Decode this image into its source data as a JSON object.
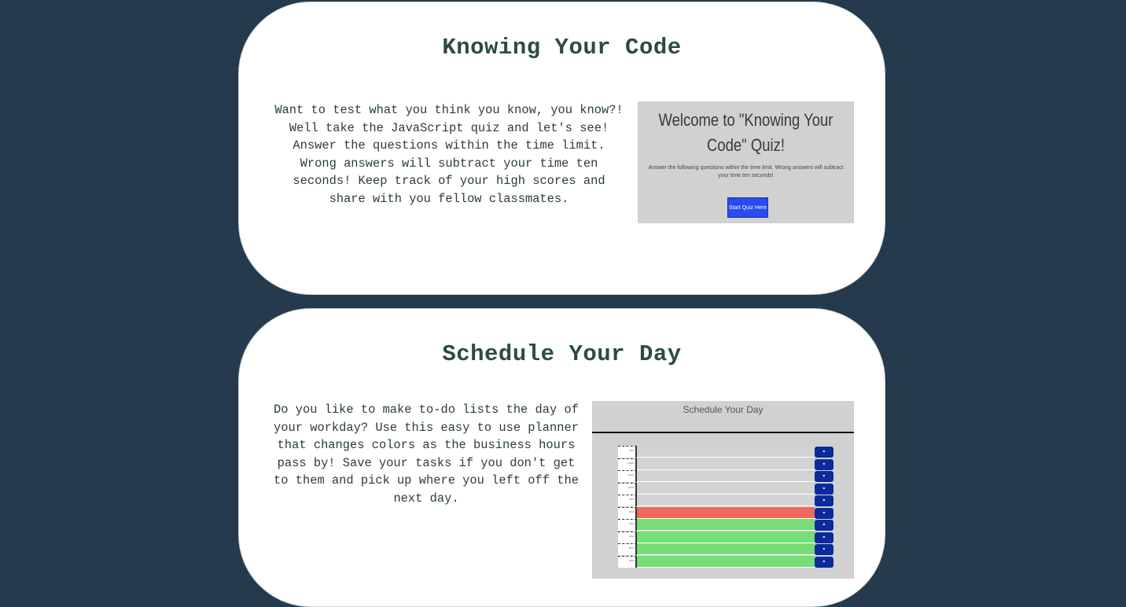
{
  "projects": [
    {
      "title": "Knowing Your Code",
      "description": "Want to test what you think you know, you know?! Well take the JavaScript quiz and let's see! Answer the questions within the time limit. Wrong answers will subtract your time ten seconds! Keep track of your high scores and share with you fellow classmates.",
      "preview": {
        "heading": "Welcome to \"Knowing Your Code\" Quiz!",
        "text": "Answer the following questions within the time limit. Wrong answers will subtract your time ten seconds!",
        "button": "Start Quiz Here"
      }
    },
    {
      "title": "Schedule Your Day",
      "description": "Do you like to make to-do lists the day of your workday? Use this easy to use planner that changes colors as the business hours pass by! Save your tasks if you don't get to them and pick up where you left off the next day.",
      "preview": {
        "heading": "Schedule Your Day",
        "rows": [
          {
            "hour": "9AM",
            "state": "past"
          },
          {
            "hour": "10AM",
            "state": "past"
          },
          {
            "hour": "11AM",
            "state": "past"
          },
          {
            "hour": "12PM",
            "state": "past"
          },
          {
            "hour": "1PM",
            "state": "past"
          },
          {
            "hour": "2PM",
            "state": "present"
          },
          {
            "hour": "3PM",
            "state": "future"
          },
          {
            "hour": "4PM",
            "state": "future"
          },
          {
            "hour": "5PM",
            "state": "future"
          },
          {
            "hour": "6PM",
            "state": "future"
          }
        ]
      }
    }
  ],
  "colors": {
    "background": "#253a4d",
    "card": "#ffffff",
    "title": "#2c4a47",
    "past": "#d3d3d3",
    "present": "#ee6961",
    "future": "#77dd77",
    "save_button": "#0b2a9c",
    "quiz_button": "#2a4bf0"
  }
}
